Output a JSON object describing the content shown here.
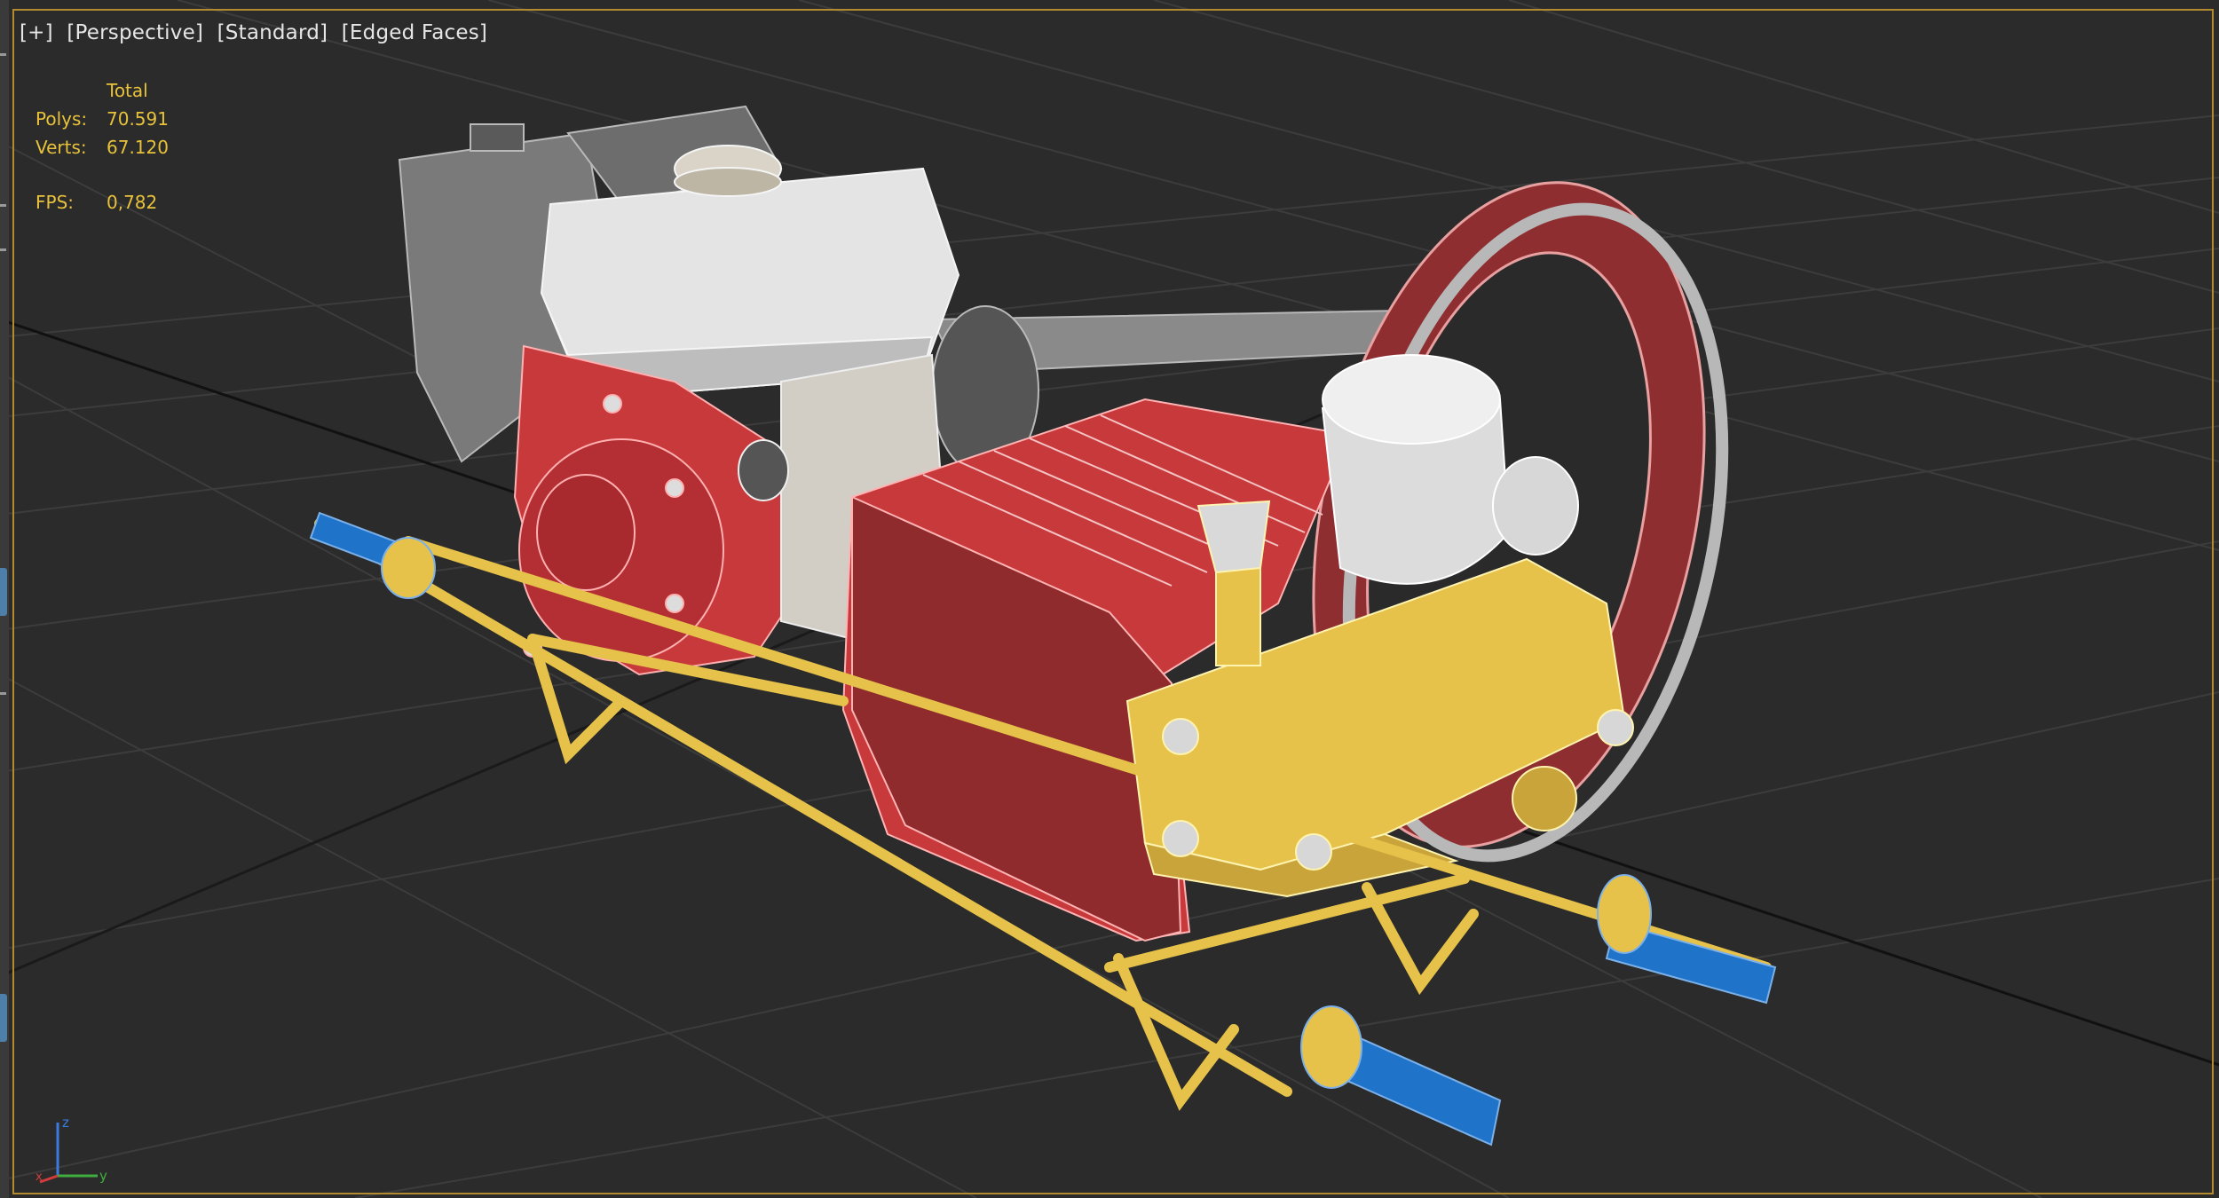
{
  "viewport": {
    "label_items": [
      "[+]",
      "[Perspective]",
      "[Standard]",
      "[Edged Faces]"
    ]
  },
  "stats": {
    "header": "Total",
    "polys_label": "Polys:",
    "polys_value": "70.591",
    "verts_label": "Verts:",
    "verts_value": "67.120",
    "fps_label": "FPS:",
    "fps_value": "0,782"
  },
  "axis_gizmo": {
    "x": "x",
    "y": "y",
    "z": "z"
  },
  "colors": {
    "background": "#2b2b2b",
    "grid": "#3f3f3f",
    "active_border": "#b48a2e",
    "stats_text": "#e8c23a",
    "frame_yellow": "#e7c24a",
    "handle_blue": "#1f73c9",
    "engine_red": "#c8393c",
    "tank_white": "#e4e4e4"
  }
}
